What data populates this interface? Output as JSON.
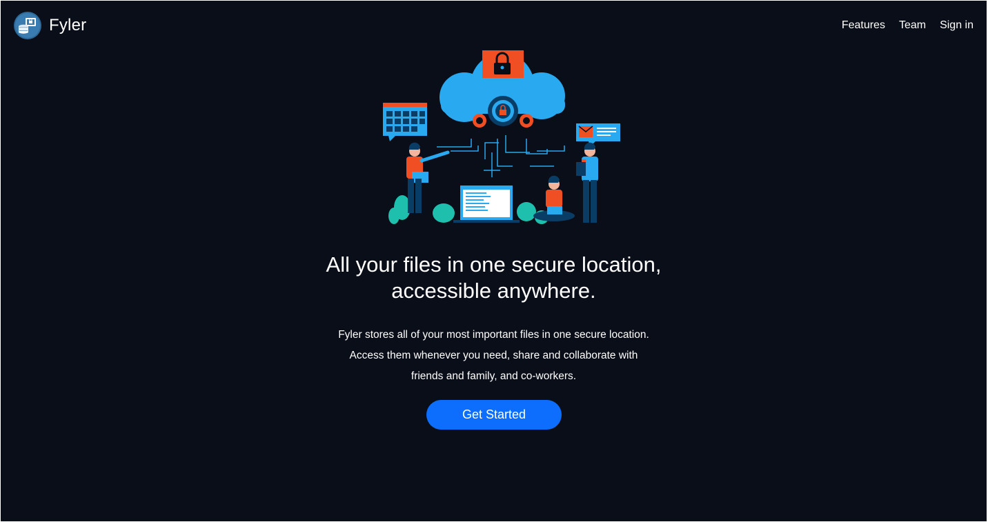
{
  "navbar": {
    "brand_name": "Fyler",
    "links": [
      {
        "label": "Features"
      },
      {
        "label": "Team"
      },
      {
        "label": "Sign in"
      }
    ]
  },
  "hero": {
    "illustration_icon": "cloud-security-illustration",
    "headline_line1": "All your files in one secure location,",
    "headline_line2": "accessible anywhere.",
    "description_line1": "Fyler stores all of your most important files in one secure location.",
    "description_line2": "Access them whenever you need, share and collaborate with",
    "description_line3": "friends and family, and co-workers.",
    "cta_label": "Get Started"
  },
  "colors": {
    "background": "#0a0e18",
    "accent": "#0d6efd",
    "cloud": "#29a9f0",
    "highlight": "#f04e23"
  }
}
